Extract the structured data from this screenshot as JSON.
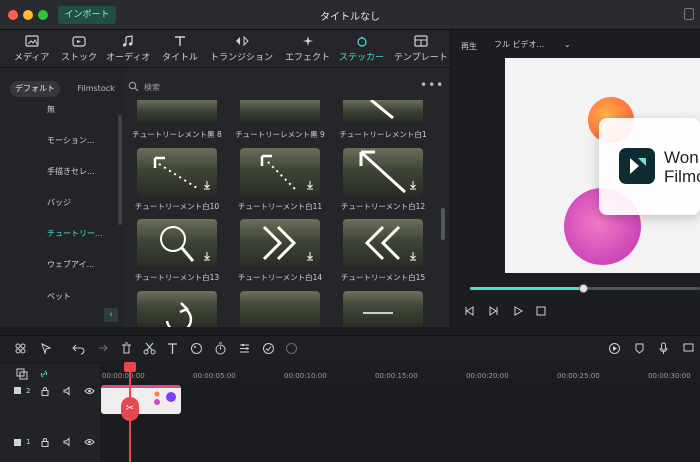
{
  "window": {
    "title": "タイトルなし",
    "import_label": "インポート"
  },
  "toolbar": {
    "items": [
      {
        "label": "メディア",
        "icon": "media-icon"
      },
      {
        "label": "ストック",
        "icon": "stock-icon"
      },
      {
        "label": "オーディオ",
        "icon": "music-note-icon"
      },
      {
        "label": "タイトル",
        "icon": "title-t-icon"
      },
      {
        "label": "トランジション",
        "icon": "transition-icon"
      },
      {
        "label": "エフェクト",
        "icon": "effect-sparkle-icon"
      },
      {
        "label": "ステッカー",
        "icon": "sticker-icon",
        "active": true
      },
      {
        "label": "テンプレート",
        "icon": "template-icon"
      }
    ]
  },
  "sidebar": {
    "tabs": [
      "デフォルト",
      "Filmstock"
    ],
    "categories": [
      "無",
      "モーション...",
      "手描きセレ...",
      "バッジ",
      "チュートリー...",
      "ウェブアイ...",
      "ペット"
    ],
    "active_category": "チュートリー..."
  },
  "search": {
    "placeholder": "検索"
  },
  "grid": {
    "top_captions": [
      "チュートリーレメント黒 8",
      "チュートリーレメント黒 9",
      "チュートリーレメント白1"
    ],
    "rows": [
      [
        "チュートリーメント白10",
        "チュートリーメント白11",
        "チュートリーメント白12"
      ],
      [
        "チュートリーメント白13",
        "チュートリーメント白14",
        "チュートリーメント白15"
      ]
    ]
  },
  "preview": {
    "label": "再生",
    "quality": "フル ビデオ...",
    "brand_line1": "Won",
    "brand_line2": "Filmo",
    "playback_progress": 0.49
  },
  "timeline": {
    "ticks": [
      "00:00:00:00",
      "00:00:05:00",
      "00:00:10:00",
      "00:00:15:00",
      "00:00:20:00",
      "00:00:25:00",
      "00:00:30:00"
    ],
    "tracks": [
      "2",
      "1"
    ]
  },
  "colors": {
    "accent": "#49e0d0",
    "playhead": "#e9474f",
    "clip_border": "#e24a86"
  }
}
